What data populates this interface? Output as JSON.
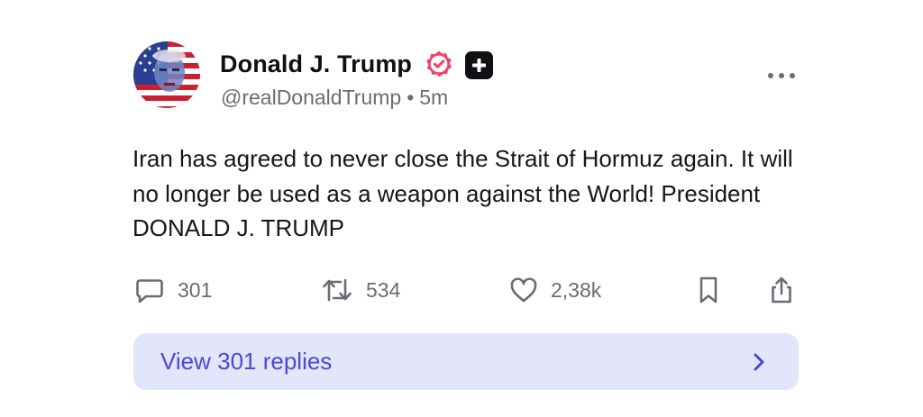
{
  "post": {
    "author_name": "Donald J. Trump",
    "handle": "@realDonaldTrump",
    "separator": "•",
    "timestamp": "5m",
    "text": "Iran has agreed to never close the Strait of Hormuz again. It will no longer be used as a weapon against the World! President DONALD J. TRUMP",
    "icons": {
      "verified": "verified-badge-icon",
      "plus_badge": "plus-badge-icon",
      "more": "more-horizontal-icon"
    }
  },
  "actions": {
    "replies_count": "301",
    "reposts_count": "534",
    "likes_count": "2,38k"
  },
  "view_replies": {
    "label": "View 301 replies"
  },
  "colors": {
    "verified": "#f0446b",
    "accent": "#4b48d6",
    "replies_bg": "#e3e6fb",
    "muted": "#6b6b76"
  }
}
